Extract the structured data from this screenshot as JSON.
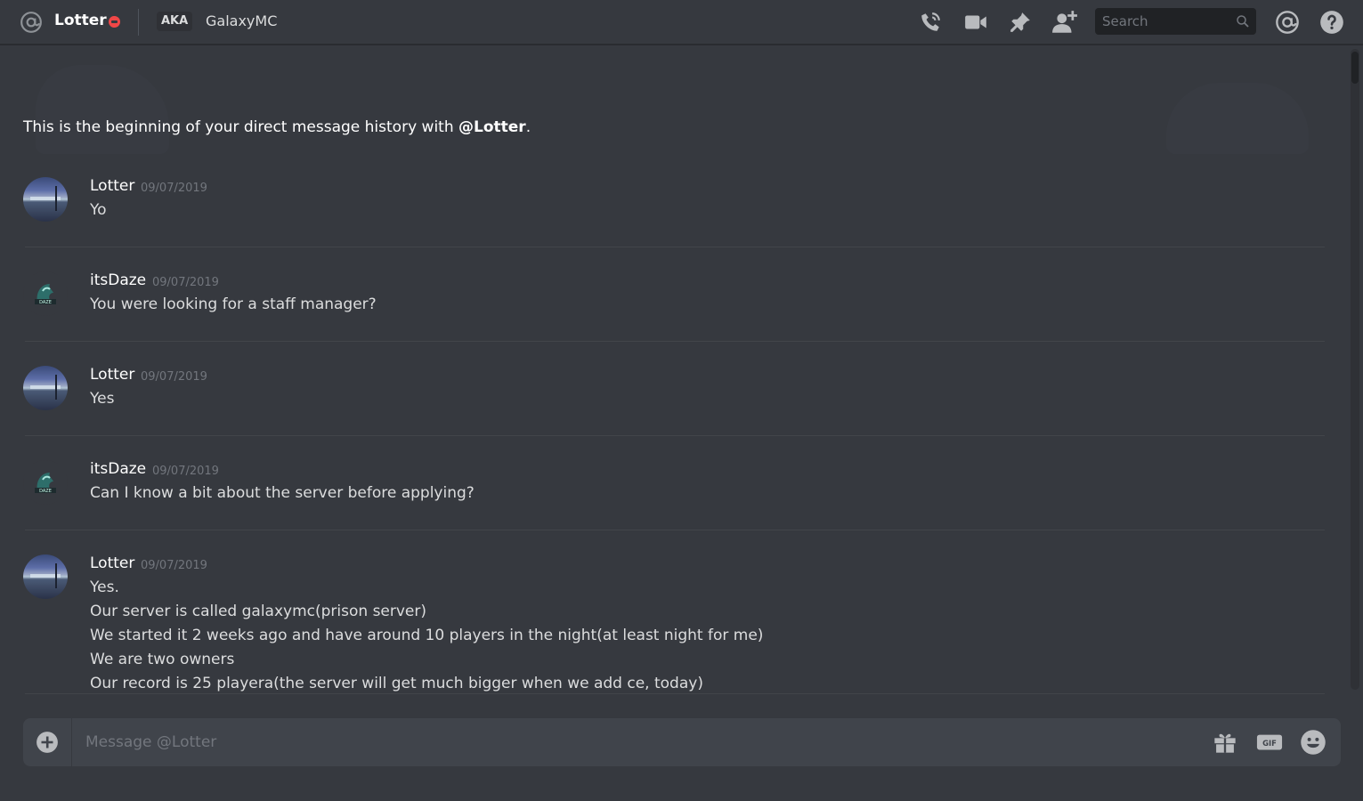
{
  "header": {
    "username": "Lotter",
    "aka_label": "AKA",
    "aka_name": "GalaxyMC",
    "search_placeholder": "Search",
    "icons": [
      "at-icon",
      "call-icon",
      "video-icon",
      "pin-icon",
      "add-friend-icon",
      "search-icon",
      "mentions-icon",
      "help-icon"
    ],
    "status_color": "#f04747"
  },
  "chat": {
    "intro_prefix": "This is the beginning of your direct message history with ",
    "intro_user": "@Lotter",
    "intro_suffix": ".",
    "messages": [
      {
        "author": "Lotter",
        "timestamp": "09/07/2019",
        "lines": [
          "Yo"
        ]
      },
      {
        "author": "itsDaze",
        "timestamp": "09/07/2019",
        "lines": [
          "You were looking for a staff manager?"
        ]
      },
      {
        "author": "Lotter",
        "timestamp": "09/07/2019",
        "lines": [
          "Yes"
        ]
      },
      {
        "author": "itsDaze",
        "timestamp": "09/07/2019",
        "lines": [
          "Can I know a bit about the server before applying?"
        ]
      },
      {
        "author": "Lotter",
        "timestamp": "09/07/2019",
        "lines": [
          "Yes.",
          "Our server is called galaxymc(prison server)",
          "We started it 2 weeks ago and have around 10 players in the night(at least night for me)",
          "We are two owners",
          "Our record is 25 playera(the server will get much bigger when we add ce, today)"
        ]
      }
    ]
  },
  "composer": {
    "placeholder": "Message @Lotter",
    "icons": [
      "add-attachment-icon",
      "gift-icon",
      "gif-icon",
      "emoji-icon"
    ],
    "gif_label": "GIF"
  },
  "colors": {
    "background": "#36393f",
    "input_bg": "#40444b",
    "text": "#dcddde",
    "muted": "#72767d"
  }
}
